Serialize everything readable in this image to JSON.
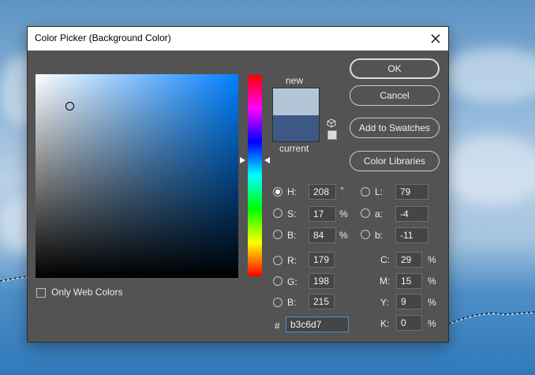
{
  "dialog": {
    "title": "Color Picker (Background Color)",
    "close_glyph": "✕"
  },
  "preview": {
    "new_label": "new",
    "current_label": "current",
    "new_color": "#b3c6d7",
    "current_color": "#3f5987"
  },
  "buttons": {
    "ok": "OK",
    "cancel": "Cancel",
    "add_to_swatches": "Add to Swatches",
    "color_libraries": "Color Libraries"
  },
  "hsb": {
    "h_label": "H:",
    "h_value": "208",
    "h_unit": "°",
    "s_label": "S:",
    "s_value": "17",
    "s_unit": "%",
    "b_label": "B:",
    "b_value": "84",
    "b_unit": "%"
  },
  "lab": {
    "l_label": "L:",
    "l_value": "79",
    "a_label": "a:",
    "a_value": "-4",
    "b_label": "b:",
    "b_value": "-11"
  },
  "rgb": {
    "r_label": "R:",
    "r_value": "179",
    "g_label": "G:",
    "g_value": "198",
    "b_label": "B:",
    "b_value": "215"
  },
  "cmyk": {
    "c_label": "C:",
    "c_value": "29",
    "c_unit": "%",
    "m_label": "M:",
    "m_value": "15",
    "m_unit": "%",
    "y_label": "Y:",
    "y_value": "9",
    "y_unit": "%",
    "k_label": "K:",
    "k_value": "0",
    "k_unit": "%"
  },
  "hex": {
    "label": "#",
    "value": "b3c6d7"
  },
  "only_web_colors": {
    "label": "Only Web Colors",
    "checked": false
  },
  "selected_mode": "H",
  "icons": {
    "close": "close-icon",
    "gamut_warning": "cube-icon",
    "websafe": "websafe-swatch-icon"
  },
  "colors": {
    "dialog_bg": "#535353",
    "accent_focus": "#4a8fd7"
  }
}
